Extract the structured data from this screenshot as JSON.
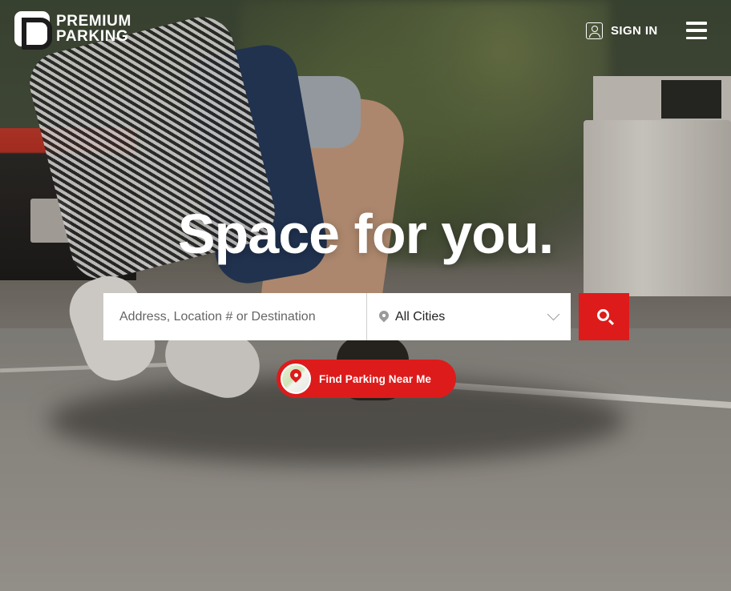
{
  "brand": {
    "line1": "PREMIUM",
    "line2": "PARKING"
  },
  "header": {
    "signin_label": "SIGN IN",
    "menu_icon": "hamburger-icon"
  },
  "hero": {
    "headline": "Space for you."
  },
  "search": {
    "placeholder": "Address, Location # or Destination",
    "value": "",
    "city": "All Cities",
    "button_icon": "search-icon"
  },
  "find_near_me": {
    "label": "Find Parking Near Me",
    "icon": "map-pin-icon"
  },
  "colors": {
    "accent": "#dd1b1b",
    "text_on_dark": "#ffffff"
  }
}
